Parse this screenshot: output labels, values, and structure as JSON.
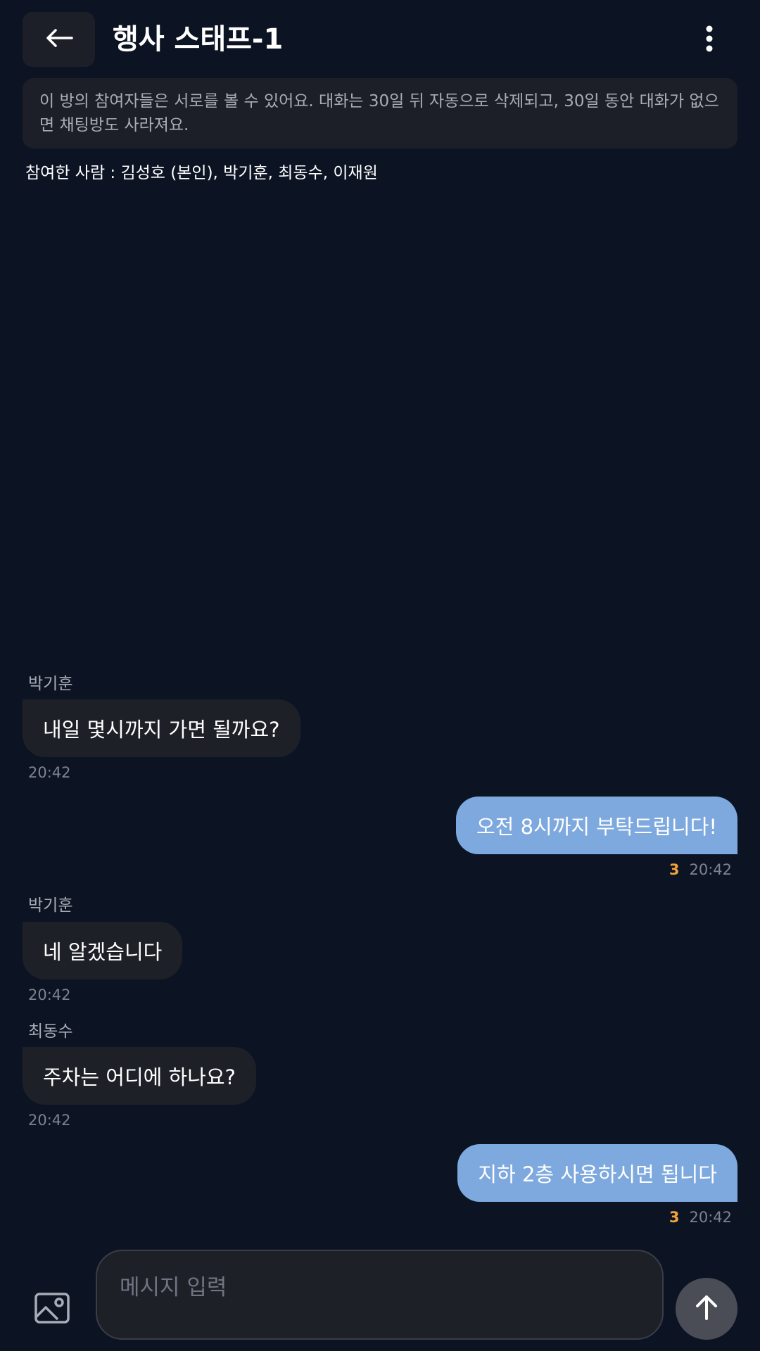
{
  "header": {
    "back_icon": "arrow-left-icon",
    "title": "행사 스태프-1",
    "menu_icon": "more-vertical-icon"
  },
  "notice": {
    "text": "이 방의 참여자들은 서로를 볼 수 있어요. 대화는 30일 뒤 자동으로 삭제되고, 30일 동안 대화가 없으면 채팅방도 사라져요."
  },
  "participants": {
    "text": "참여한 사람 : 김성호 (본인), 박기훈, 최동수, 이재원"
  },
  "messages": [
    {
      "direction": "in",
      "sender": "박기훈",
      "text": "내일 몇시까지 가면 될까요?",
      "time": "20:42"
    },
    {
      "direction": "out",
      "text": "오전 8시까지 부탁드립니다!",
      "read_count": "3",
      "time": "20:42"
    },
    {
      "direction": "in",
      "sender": "박기훈",
      "text": "네 알겠습니다",
      "time": "20:42"
    },
    {
      "direction": "in",
      "sender": "최동수",
      "text": "주차는 어디에 하나요?",
      "time": "20:42"
    },
    {
      "direction": "out",
      "text": "지하 2층 사용하시면 됩니다",
      "read_count": "3",
      "time": "20:42"
    }
  ],
  "composer": {
    "image_icon": "image-icon",
    "placeholder": "메시지 입력",
    "send_icon": "arrow-up-icon"
  },
  "colors": {
    "background": "#0c1424",
    "incoming_bubble": "#1e2028",
    "outgoing_bubble": "#7ea9de",
    "read_count": "#f2a53a"
  }
}
